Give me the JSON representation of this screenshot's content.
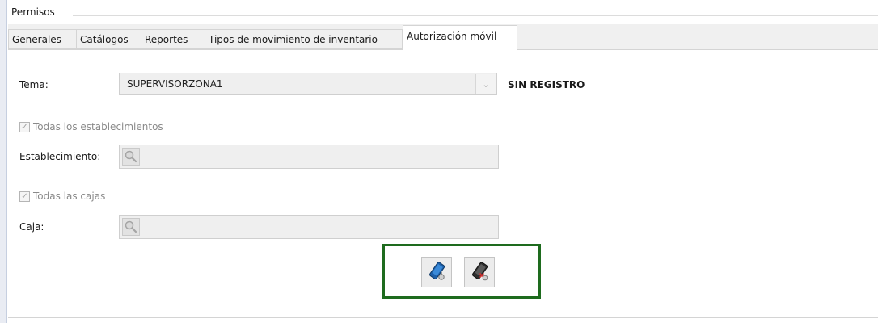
{
  "group": {
    "title": "Permisos"
  },
  "tabs": [
    {
      "label": "Generales"
    },
    {
      "label": "Catálogos"
    },
    {
      "label": "Reportes"
    },
    {
      "label": "Tipos de movimiento de inventario"
    },
    {
      "label": "Autorización móvil",
      "active": true
    }
  ],
  "form": {
    "tema_label": "Tema:",
    "tema_value": "SUPERVISORZONA1",
    "status_text": "SIN REGISTRO",
    "all_establishments_label": "Todas los establecimientos",
    "all_establishments_checked": true,
    "establecimiento_label": "Establecimiento:",
    "all_cajas_label": "Todas las cajas",
    "all_cajas_checked": true,
    "caja_label": "Caja:"
  },
  "actions": {
    "authorize_icon": "mobile-authorize-icon",
    "revoke_icon": "mobile-revoke-icon"
  },
  "colors": {
    "frame_green": "#1e6b1e",
    "field_background": "#efefef"
  }
}
